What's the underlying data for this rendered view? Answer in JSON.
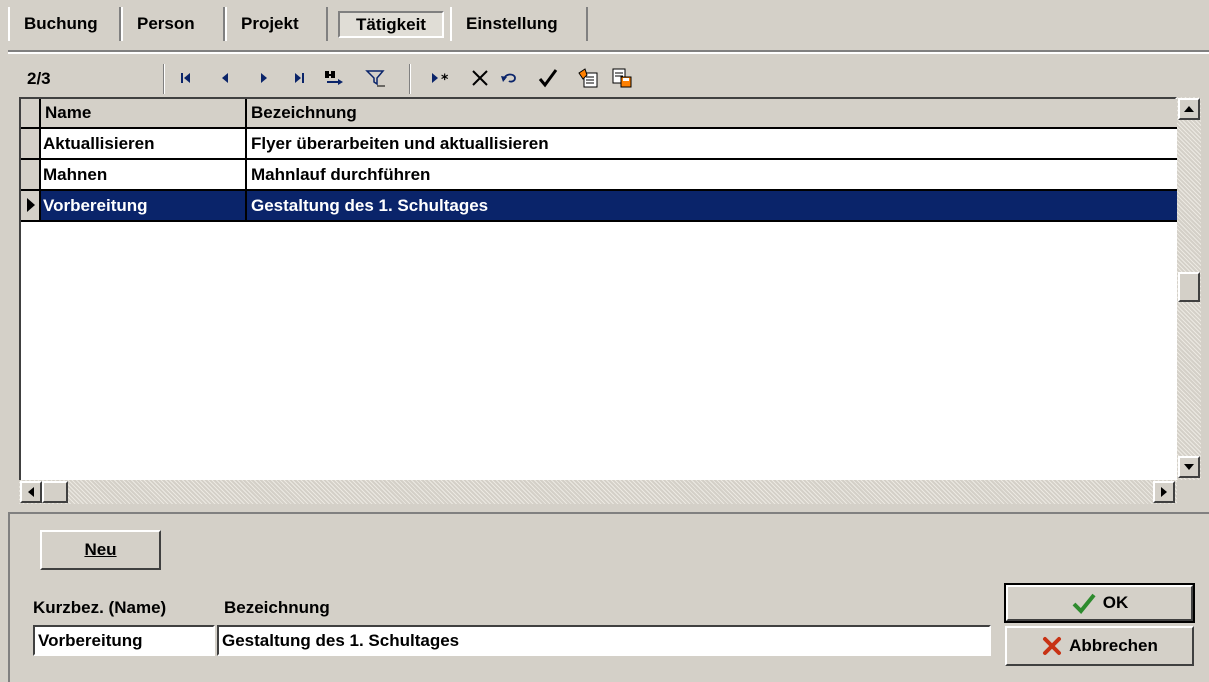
{
  "tabs": [
    {
      "label": "Buchung"
    },
    {
      "label": "Person"
    },
    {
      "label": "Projekt"
    },
    {
      "label": "Tätigkeit",
      "active": true
    },
    {
      "label": "Einstellung"
    }
  ],
  "toolbar": {
    "record_position": "2/3",
    "icons": [
      "first-record-icon",
      "prev-record-icon",
      "next-record-icon",
      "last-record-icon",
      "find-icon",
      "filter-icon",
      "new-record-icon",
      "delete-icon",
      "undo-icon",
      "save-check-icon",
      "copy-icon",
      "paste-icon"
    ]
  },
  "grid": {
    "columns": [
      "Name",
      "Bezeichnung"
    ],
    "rows": [
      {
        "name": "Aktuallisieren",
        "bezeichnung": "Flyer überarbeiten und aktuallisieren"
      },
      {
        "name": "Mahnen",
        "bezeichnung": "Mahnlauf durchführen"
      },
      {
        "name": "Vorbereitung",
        "bezeichnung": "Gestaltung des 1. Schultages",
        "selected": true
      }
    ],
    "selection_color": "#0a246a"
  },
  "form": {
    "new_label": "Neu",
    "short_label": "Kurzbez. (Name)",
    "desc_label": "Bezeichnung",
    "short_value": "Vorbereitung",
    "desc_value": "Gestaltung des 1. Schultages",
    "ok_label": "OK",
    "cancel_label": "Abbrechen"
  }
}
